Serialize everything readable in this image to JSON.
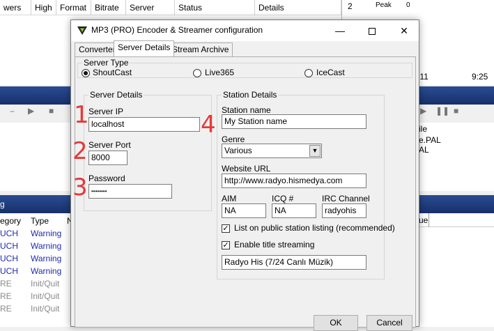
{
  "background": {
    "table_headers": [
      "wers",
      "High",
      "Format",
      "Bitrate",
      "Server",
      "Status",
      "Details"
    ],
    "right_panel": {
      "row_index": "2",
      "peak_label": "Peak",
      "peak_value": "0"
    },
    "time_left": ":11",
    "time_right": "9:25",
    "file_items": [
      "ile",
      "e.PAL",
      "AL"
    ],
    "right_header": "ue",
    "log_rows": [
      {
        "category": "egory",
        "type": "Type",
        "n": "N"
      },
      {
        "category": "UCH",
        "type": "Warning"
      },
      {
        "category": "UCH",
        "type": "Warning"
      },
      {
        "category": "UCH",
        "type": "Warning"
      },
      {
        "category": "UCH",
        "type": "Warning"
      },
      {
        "category": "RE",
        "type": "Init/Quit"
      },
      {
        "category": "RE",
        "type": "Init/Quit"
      },
      {
        "category": "RE",
        "type": "Init/Quit"
      }
    ],
    "log_header_letter": "g"
  },
  "dialog": {
    "title": "MP3 (PRO) Encoder & Streamer configuration",
    "tabs": [
      "Converter",
      "Server Details",
      "Stream Archive"
    ],
    "active_tab": "Server Details",
    "server_type": {
      "label": "Server Type",
      "options": [
        "ShoutCast",
        "Live365",
        "IceCast"
      ],
      "selected": "ShoutCast"
    },
    "server_details": {
      "label": "Server Details",
      "ip_label": "Server IP",
      "ip_value": "localhost",
      "port_label": "Server Port",
      "port_value": "8000",
      "password_label": "Password",
      "password_value": "••••••••"
    },
    "station_details": {
      "label": "Station Details",
      "name_label": "Station name",
      "name_value": "My Station name",
      "genre_label": "Genre",
      "genre_value": "Various",
      "url_label": "Website URL",
      "url_value": "http://www.radyo.hismedya.com",
      "aim_label": "AIM",
      "aim_value": "NA",
      "icq_label": "ICQ #",
      "icq_value": "NA",
      "irc_label": "IRC Channel",
      "irc_value": "radyohis",
      "list_public_label": "List on public station listing (recommended)",
      "list_public_checked": true,
      "title_streaming_label": "Enable title streaming",
      "title_streaming_checked": true,
      "title_value": "Radyo His (7/24 Canlı Müzik)"
    },
    "ok_label": "OK",
    "cancel_label": "Cancel"
  },
  "annotations": [
    "1",
    "2",
    "3",
    "4"
  ]
}
